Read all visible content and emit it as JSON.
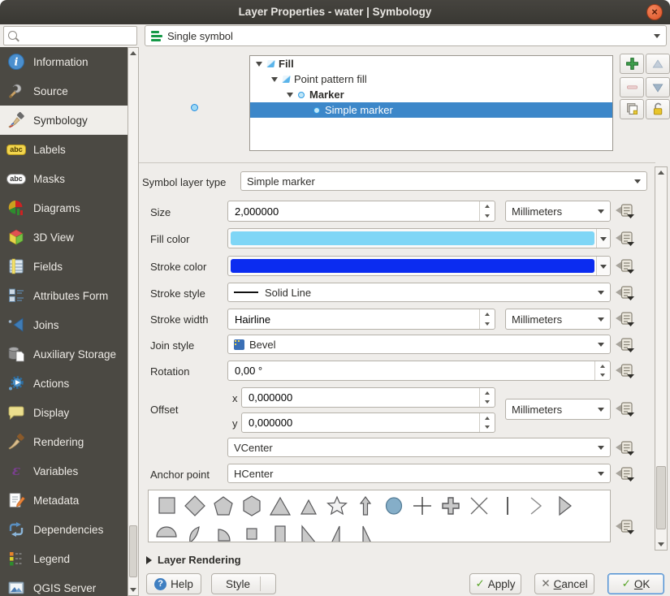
{
  "window": {
    "title": "Layer Properties - water | Symbology",
    "close_glyph": "×"
  },
  "search": {
    "placeholder": ""
  },
  "renderer": {
    "value": "Single symbol"
  },
  "sidebar": {
    "selected": "Symbology",
    "items": [
      {
        "label": "Information",
        "icon": "information-icon"
      },
      {
        "label": "Source",
        "icon": "source-icon"
      },
      {
        "label": "Symbology",
        "icon": "symbology-icon"
      },
      {
        "label": "Labels",
        "icon": "labels-icon"
      },
      {
        "label": "Masks",
        "icon": "masks-icon"
      },
      {
        "label": "Diagrams",
        "icon": "diagrams-icon"
      },
      {
        "label": "3D View",
        "icon": "3d-view-icon"
      },
      {
        "label": "Fields",
        "icon": "fields-icon"
      },
      {
        "label": "Attributes Form",
        "icon": "attributes-form-icon"
      },
      {
        "label": "Joins",
        "icon": "joins-icon"
      },
      {
        "label": "Auxiliary Storage",
        "icon": "auxiliary-storage-icon"
      },
      {
        "label": "Actions",
        "icon": "actions-icon"
      },
      {
        "label": "Display",
        "icon": "display-icon"
      },
      {
        "label": "Rendering",
        "icon": "rendering-icon"
      },
      {
        "label": "Variables",
        "icon": "variables-icon"
      },
      {
        "label": "Metadata",
        "icon": "metadata-icon"
      },
      {
        "label": "Dependencies",
        "icon": "dependencies-icon"
      },
      {
        "label": "Legend",
        "icon": "legend-icon"
      },
      {
        "label": "QGIS Server",
        "icon": "qgis-server-icon"
      }
    ]
  },
  "symbol_tree": {
    "selected": "Simple marker",
    "rows": [
      {
        "label": "Fill"
      },
      {
        "label": "Point pattern fill"
      },
      {
        "label": "Marker"
      },
      {
        "label": "Simple marker"
      }
    ]
  },
  "tree_tools": [
    "add-symbol-layer",
    "move-up",
    "remove-symbol-layer",
    "move-down",
    "duplicate-symbol-layer",
    "lock-color"
  ],
  "fields": {
    "symbol_layer_type": {
      "label": "Symbol layer type",
      "value": "Simple marker"
    },
    "size": {
      "label": "Size",
      "value": "2,000000",
      "unit": "Millimeters"
    },
    "fill_color": {
      "label": "Fill color"
    },
    "stroke_color": {
      "label": "Stroke color"
    },
    "stroke_style": {
      "label": "Stroke style",
      "value": "Solid Line"
    },
    "stroke_width": {
      "label": "Stroke width",
      "value": "Hairline",
      "unit": "Millimeters"
    },
    "join_style": {
      "label": "Join style",
      "value": "Bevel"
    },
    "rotation": {
      "label": "Rotation",
      "value": "0,00 °"
    },
    "offset": {
      "label": "Offset",
      "x_label": "x",
      "x_value": "0,000000",
      "y_label": "y",
      "y_value": "0,000000",
      "unit": "Millimeters"
    },
    "anchor_point": {
      "label": "Anchor point",
      "vertical": "VCenter",
      "horizontal": "HCenter"
    }
  },
  "gallery": {
    "selected": "circle",
    "row1": [
      "square",
      "diamond",
      "pentagon",
      "hexagon",
      "triangle",
      "equilateral-triangle",
      "star",
      "arrow",
      "circle",
      "cross",
      "cross-fill",
      "cross2",
      "line",
      "arrowhead",
      "filled-arrowhead"
    ],
    "row2": [
      "semi-circle",
      "third-circle",
      "quarter-circle",
      "quarter-square",
      "half-square",
      "diagonal-half-square",
      "right-half-triangle",
      "left-half-triangle"
    ]
  },
  "layer_rendering": {
    "label": "Layer Rendering"
  },
  "footer": {
    "help": "Help",
    "style": "Style",
    "apply": "Apply",
    "cancel_mnemonic": "C",
    "cancel_rest": "ancel",
    "ok_mnemonic": "O",
    "ok_rest": "K"
  },
  "colors": {
    "fill_color": "#7fd6f6",
    "stroke_color": "#0b2cf0",
    "selection_blue": "#3c87c9",
    "titlebar": "#3c3b37",
    "close_orange": "#e2571f",
    "sidebar_bg": "#4b4943"
  }
}
